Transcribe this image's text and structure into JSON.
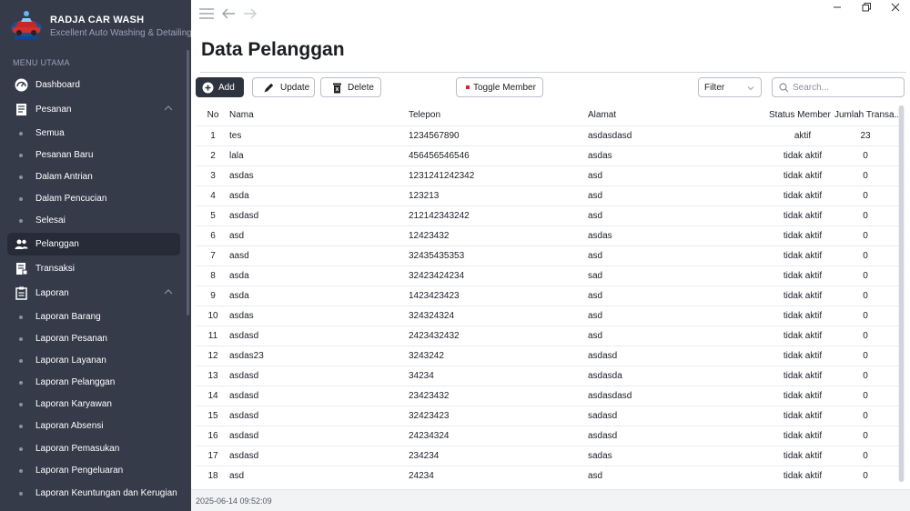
{
  "brand": {
    "title": "RADJA CAR WASH",
    "subtitle": "Excellent Auto Washing & Detailing"
  },
  "sidebar": {
    "section_title": "MENU UTAMA",
    "dashboard": "Dashboard",
    "pesanan": "Pesanan",
    "pesanan_sub": [
      "Semua",
      "Pesanan Baru",
      "Dalam Antrian",
      "Dalam Pencucian",
      "Selesai"
    ],
    "pelanggan": "Pelanggan",
    "transaksi": "Transaksi",
    "laporan": "Laporan",
    "laporan_sub": [
      "Laporan Barang",
      "Laporan Pesanan",
      "Laporan Layanan",
      "Laporan Pelanggan",
      "Laporan Karyawan",
      "Laporan Absensi",
      "Laporan Pemasukan",
      "Laporan Pengeluaran",
      "Laporan Keuntungan dan Kerugian"
    ]
  },
  "page": {
    "title": "Data Pelanggan"
  },
  "toolbar": {
    "add": "Add",
    "update": "Update",
    "delete": "Delete",
    "toggle_member": "Toggle Member",
    "filter": "Filter",
    "search_placeholder": "Search..."
  },
  "table": {
    "columns": [
      "No",
      "Nama",
      "Telepon",
      "Alamat",
      "Status Member",
      "Jumlah Transa..."
    ],
    "rows": [
      [
        "1",
        "tes",
        "1234567890",
        "asdasdasd",
        "aktif",
        "23"
      ],
      [
        "2",
        "lala",
        "456456546546",
        "asdas",
        "tidak aktif",
        "0"
      ],
      [
        "3",
        "asdas",
        "1231241242342",
        "asd",
        "tidak aktif",
        "0"
      ],
      [
        "4",
        "asda",
        "123213",
        "asd",
        "tidak aktif",
        "0"
      ],
      [
        "5",
        "asdasd",
        "212142343242",
        "asd",
        "tidak aktif",
        "0"
      ],
      [
        "6",
        "asd",
        "12423432",
        "asdas",
        "tidak aktif",
        "0"
      ],
      [
        "7",
        "aasd",
        "32435435353",
        "asd",
        "tidak aktif",
        "0"
      ],
      [
        "8",
        "asda",
        "32423424234",
        "sad",
        "tidak aktif",
        "0"
      ],
      [
        "9",
        "asda",
        "1423423423",
        "asd",
        "tidak aktif",
        "0"
      ],
      [
        "10",
        "asdas",
        "324324324",
        "asd",
        "tidak aktif",
        "0"
      ],
      [
        "11",
        "asdasd",
        "2423432432",
        "asd",
        "tidak aktif",
        "0"
      ],
      [
        "12",
        "asdas23",
        "3243242",
        "asdasd",
        "tidak aktif",
        "0"
      ],
      [
        "13",
        "asdasd",
        "34234",
        "asdasda",
        "tidak aktif",
        "0"
      ],
      [
        "14",
        "asdasd",
        "23423432",
        "asdasdasd",
        "tidak aktif",
        "0"
      ],
      [
        "15",
        "asdasd",
        "32423423",
        "sadasd",
        "tidak aktif",
        "0"
      ],
      [
        "16",
        "asdasd",
        "24234324",
        "asdasd",
        "tidak aktif",
        "0"
      ],
      [
        "17",
        "asdasd",
        "234234",
        "sadas",
        "tidak aktif",
        "0"
      ],
      [
        "18",
        "asd",
        "24234",
        "asd",
        "tidak aktif",
        "0"
      ]
    ]
  },
  "status": {
    "timestamp": "2025-06-14 09:52:09"
  },
  "icons": {
    "add": "plus-circle-icon",
    "update": "pencil-icon",
    "delete": "trash-icon",
    "toggle": "red-square-icon",
    "search": "magnifier-icon"
  },
  "colors": {
    "sidebar_bg": "#363b4a",
    "sidebar_active": "#272b37",
    "primary_button": "#2e3340",
    "toggle_marker": "#e02020"
  }
}
